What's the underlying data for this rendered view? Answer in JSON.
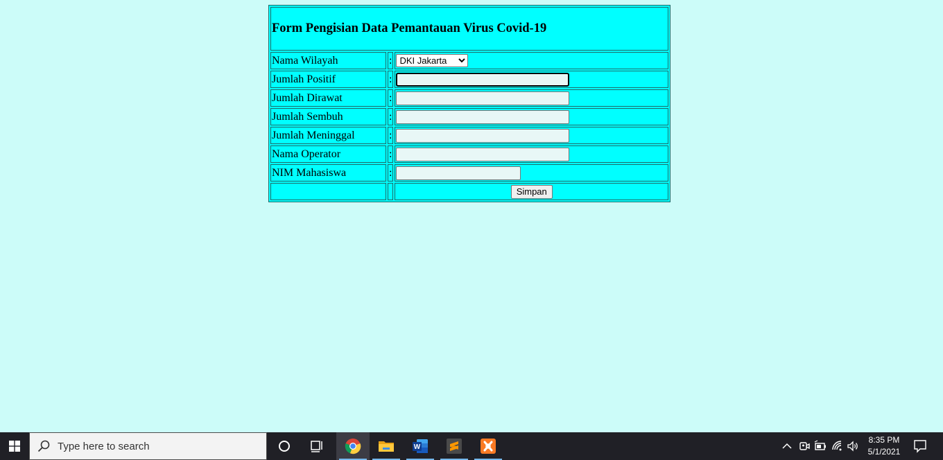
{
  "form": {
    "title": "Form Pengisian Data Pemantauan Virus Covid-19",
    "separator": ":",
    "rows": [
      {
        "label": "Nama Wilayah",
        "type": "select",
        "value": "DKI Jakarta"
      },
      {
        "label": "Jumlah Positif",
        "type": "text",
        "value": ""
      },
      {
        "label": "Jumlah Dirawat",
        "type": "text",
        "value": ""
      },
      {
        "label": "Jumlah Sembuh",
        "type": "text",
        "value": ""
      },
      {
        "label": "Jumlah Meninggal",
        "type": "text",
        "value": ""
      },
      {
        "label": "Nama Operator",
        "type": "text",
        "value": ""
      },
      {
        "label": "NIM Mahasiswa",
        "type": "text",
        "value": ""
      }
    ],
    "submit_label": "Simpan"
  },
  "taskbar": {
    "search_placeholder": "Type here to search",
    "apps": [
      "task-view-cortana",
      "task-view",
      "chrome",
      "file-explorer",
      "word",
      "sublime-text",
      "xampp"
    ],
    "clock_time": "8:35 PM",
    "clock_date": "5/1/2021"
  },
  "colors": {
    "page_bg": "#ccfcf9",
    "form_bg": "#00ffff",
    "border": "#1e6b68",
    "taskbar_bg": "#202026"
  }
}
